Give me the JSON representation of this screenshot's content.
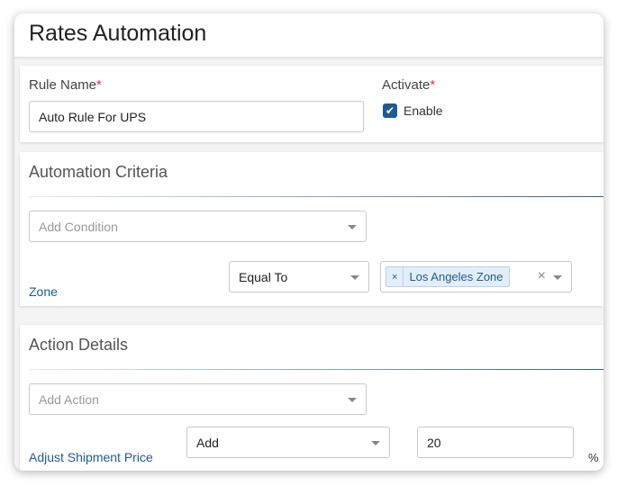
{
  "title": "Rates Automation",
  "rule": {
    "label": "Rule Name",
    "required": "*",
    "value": "Auto Rule For UPS"
  },
  "activate": {
    "label": "Activate",
    "required": "*",
    "checkbox_label": "Enable",
    "checked": true
  },
  "criteria": {
    "title": "Automation Criteria",
    "add_placeholder": "Add Condition",
    "condition": {
      "field": "Zone",
      "operator": "Equal To",
      "tags": [
        "Los Angeles Zone"
      ]
    }
  },
  "actions": {
    "title": "Action Details",
    "add_placeholder": "Add Action",
    "action": {
      "field": "Adjust Shipment Price",
      "operator": "Add",
      "value": "20",
      "unit": "%"
    }
  },
  "colors": {
    "accent": "#1f5a96",
    "required": "#dd3333"
  }
}
